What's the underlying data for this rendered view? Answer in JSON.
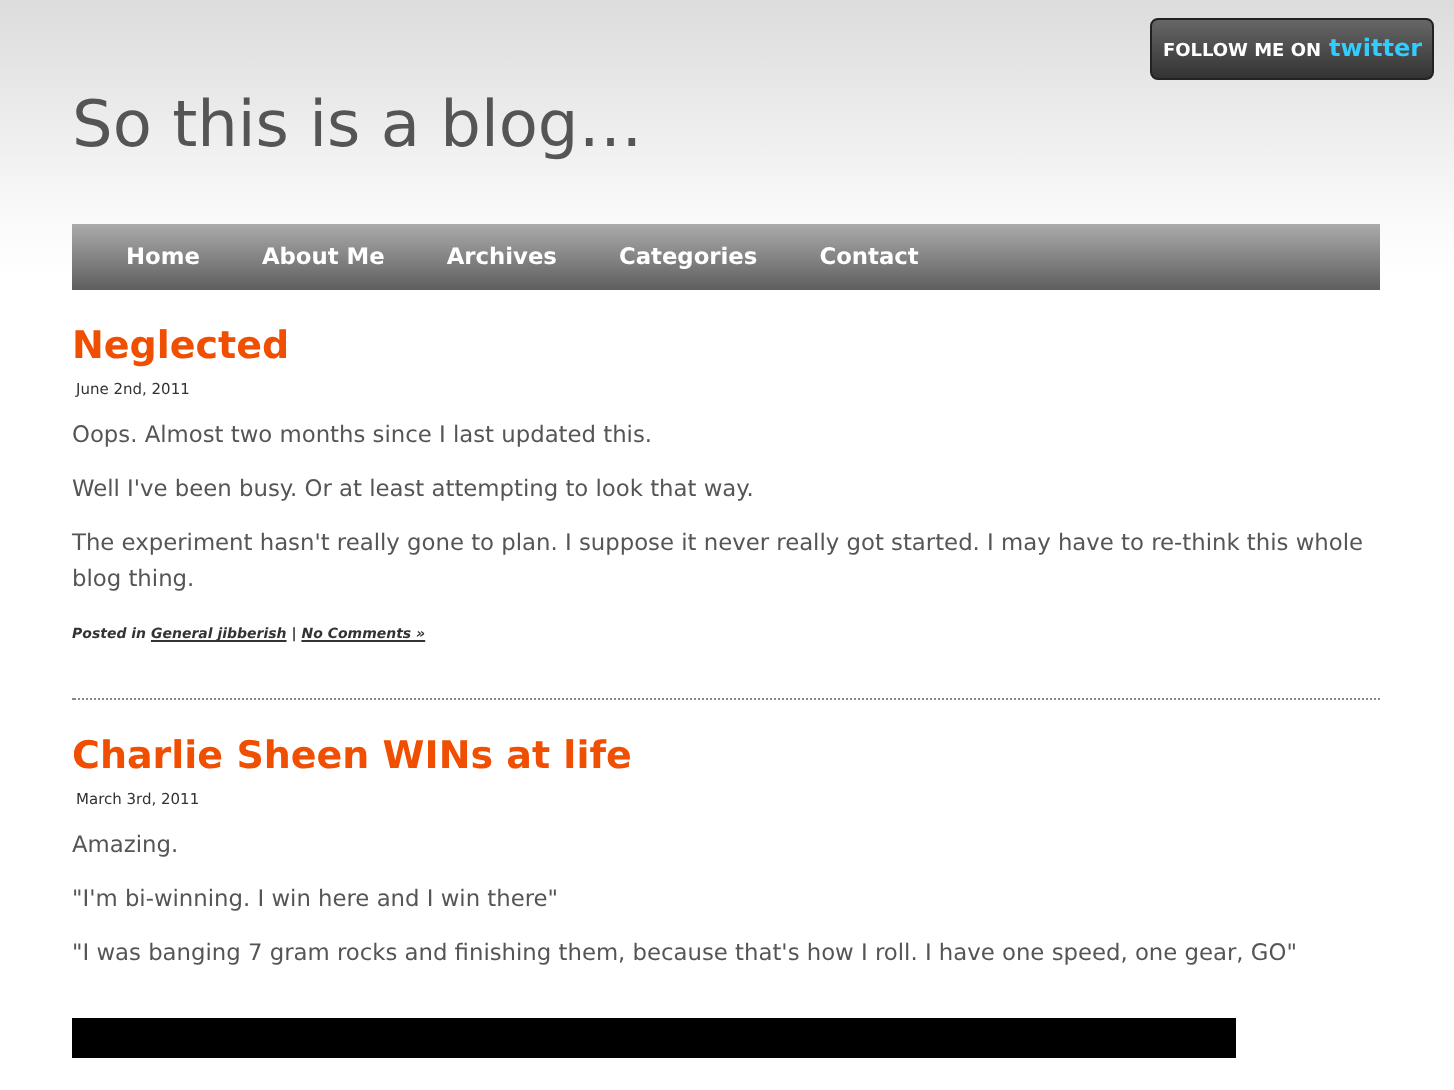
{
  "follow_button": {
    "label": "FOLLOW ME ON",
    "brand": "twitter"
  },
  "site_title": "So this is a blog…",
  "nav": [
    {
      "label": "Home"
    },
    {
      "label": "About Me"
    },
    {
      "label": "Archives"
    },
    {
      "label": "Categories"
    },
    {
      "label": "Contact"
    }
  ],
  "posts": [
    {
      "title": "Neglected",
      "date": "June 2nd, 2011",
      "paragraphs": [
        "Oops. Almost two months since I last updated this.",
        "Well I've been busy. Or at least attempting to look that way.",
        "The experiment hasn't really gone to plan. I suppose it never really got started. I may have to re-think this whole blog thing."
      ],
      "meta": {
        "prefix": "Posted in",
        "category": "General jibberish",
        "separator": "|",
        "comments": "No Comments »"
      }
    },
    {
      "title": "Charlie Sheen WINs at life",
      "date": "March 3rd, 2011",
      "paragraphs": [
        "Amazing.",
        "\"I'm bi-winning. I win here and I win there\"",
        "\"I was banging 7 gram rocks and finishing them, because that's how I roll. I have one speed, one gear, GO\""
      ],
      "video": true
    }
  ]
}
